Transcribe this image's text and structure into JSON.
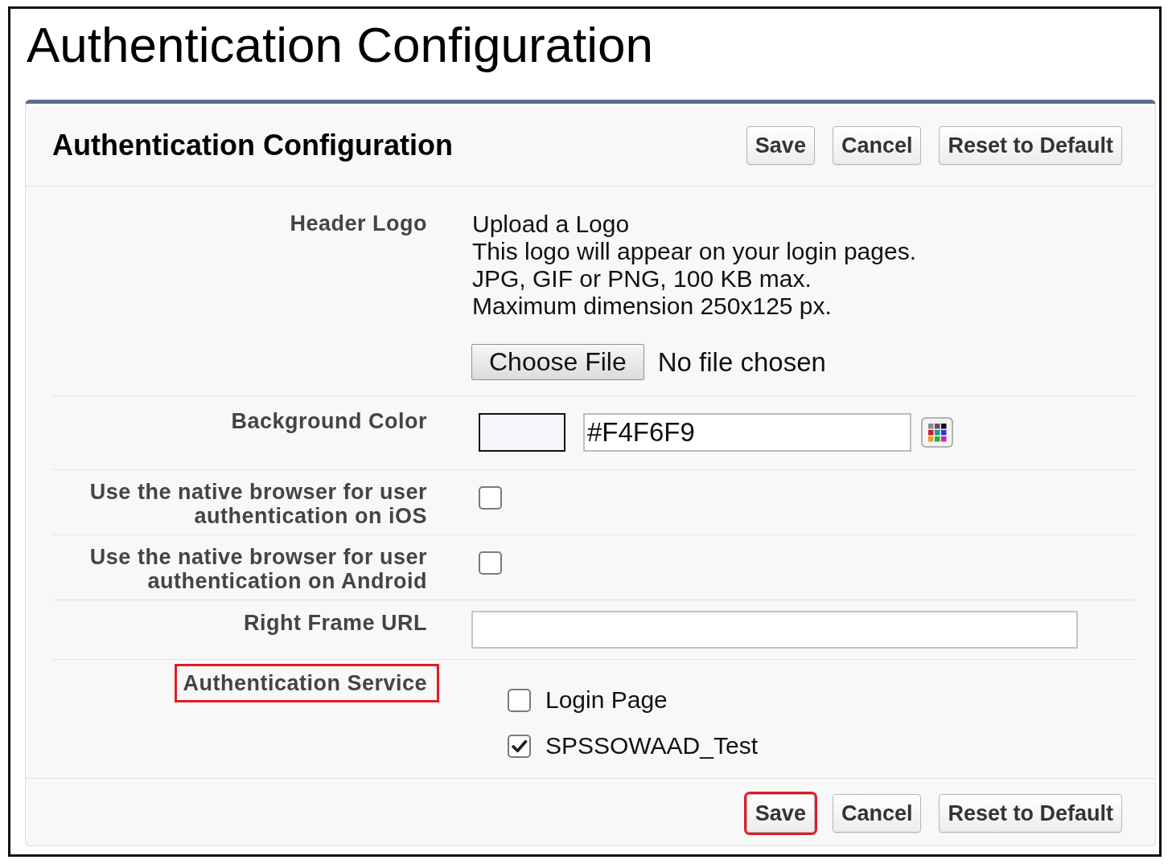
{
  "page_title": "Authentication Configuration",
  "panel": {
    "title": "Authentication Configuration",
    "header_buttons": [
      {
        "label": "Save"
      },
      {
        "label": "Cancel"
      },
      {
        "label": "Reset to Default"
      }
    ],
    "fields": [
      {
        "kind": "upload",
        "label": "Header Logo",
        "highlighted": false,
        "lines": [
          "Upload a Logo",
          "This logo will appear on your login pages.",
          "JPG, GIF or PNG, 100 KB max.",
          "Maximum dimension 250x125 px."
        ],
        "button": "Choose File",
        "file_status": "No file chosen"
      },
      {
        "kind": "color",
        "label": "Background Color",
        "highlighted": false,
        "value": "#F4F6F9",
        "color": "#f4f6f9"
      },
      {
        "kind": "checkbox",
        "label": "Use the native browser for user authentication on iOS",
        "highlighted": false,
        "checked": false
      },
      {
        "kind": "checkbox",
        "label": "Use the native browser for user authentication on Android",
        "highlighted": false,
        "checked": false
      },
      {
        "kind": "text",
        "label": "Right Frame URL",
        "highlighted": false
      },
      {
        "kind": "checklist",
        "label": "Authentication Service",
        "highlighted": true,
        "options": [
          {
            "label": "Login Page",
            "checked": false
          },
          {
            "label": "SPSSOWAAD_Test",
            "checked": true
          }
        ]
      }
    ],
    "footer_buttons": [
      {
        "label": "Save",
        "highlighted": true
      },
      {
        "label": "Cancel",
        "highlighted": false
      },
      {
        "label": "Reset to Default",
        "highlighted": false
      }
    ]
  }
}
